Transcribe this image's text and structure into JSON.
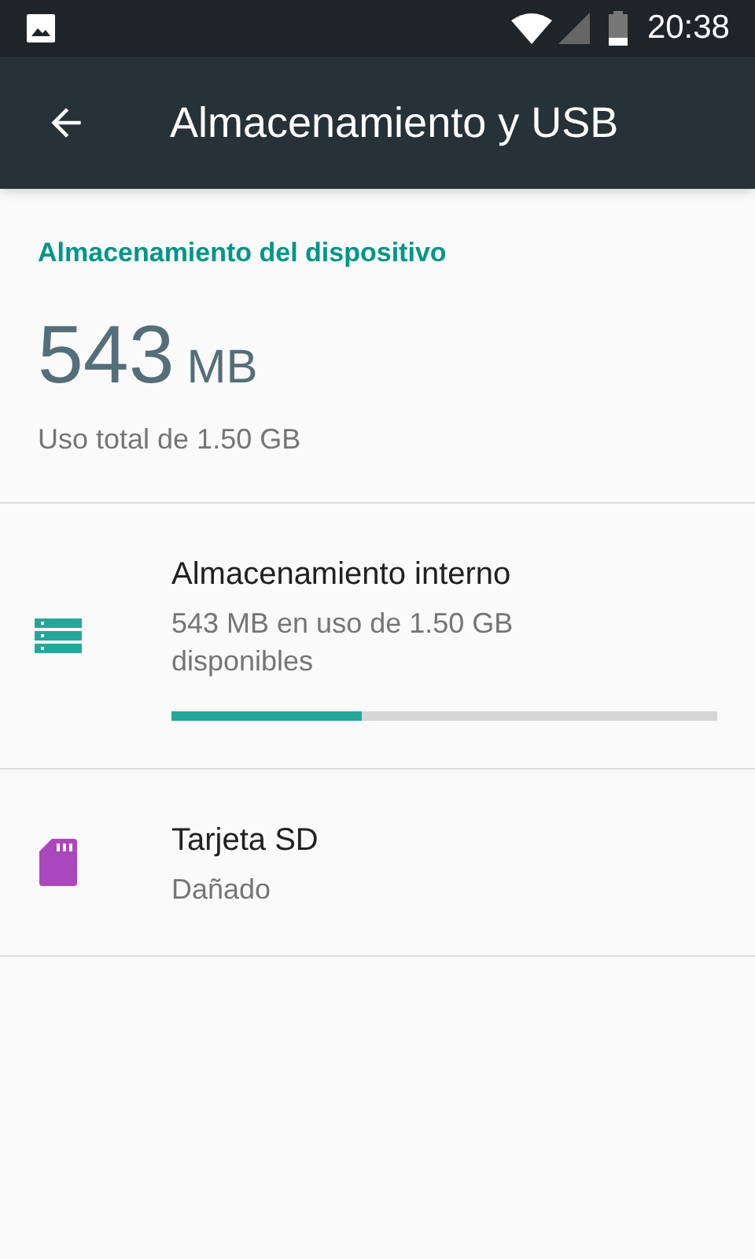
{
  "status_bar": {
    "time": "20:38"
  },
  "toolbar": {
    "title": "Almacenamiento y USB"
  },
  "section": {
    "header": "Almacenamiento del dispositivo",
    "used_value": "543",
    "used_unit": "MB",
    "total": "Uso total de 1.50 GB"
  },
  "volumes": [
    {
      "kind": "internal",
      "color": "#26a69a",
      "title": "Almacenamiento interno",
      "summary": "543 MB en uso de 1.50 GB disponibles",
      "level": 0.35
    },
    {
      "kind": "sd",
      "color": "#ab47bc",
      "title": "Tarjeta SD",
      "summary": "Dañado"
    }
  ]
}
